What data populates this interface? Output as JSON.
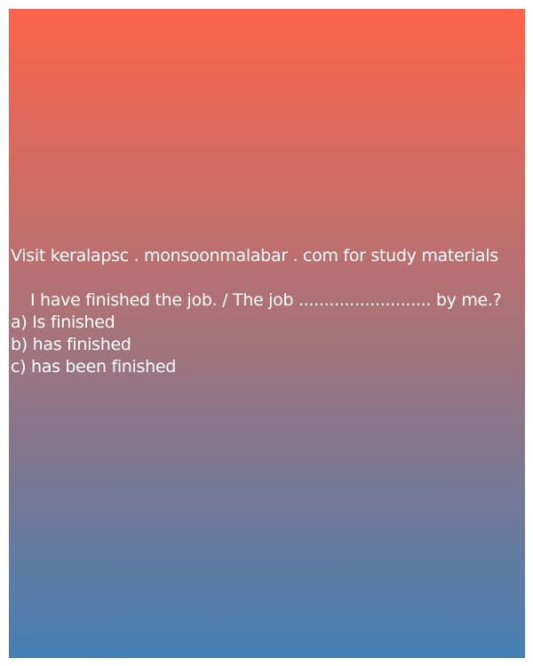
{
  "promo": {
    "text": "Visit keralapsc . monsoonmalabar . com for study materials"
  },
  "question": {
    "prompt": "I have finished the job. / The job .......................... by me.?",
    "options": [
      "a) Is finished",
      "b) has finished",
      "c) has been finished"
    ]
  },
  "colors": {
    "gradient_top": "#fd644a",
    "gradient_middle": "#a6737a",
    "gradient_bottom": "#447fb3",
    "text": "#ffffff"
  }
}
